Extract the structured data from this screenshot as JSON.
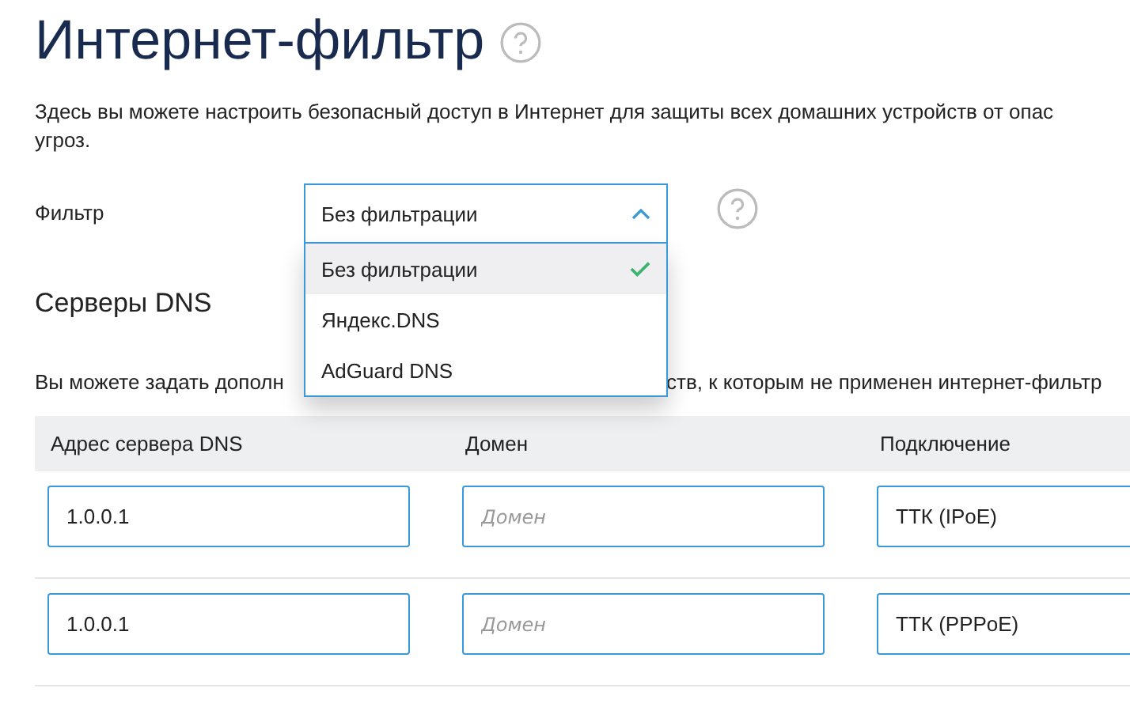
{
  "title": "Интернет-фильтр",
  "description": "Здесь вы можете настроить безопасный доступ в Интернет для защиты всех домашних устройств от опас угроз.",
  "filter": {
    "label": "Фильтр",
    "value": "Без фильтрации",
    "expanded": true,
    "options": [
      {
        "label": "Без фильтрации",
        "selected": true
      },
      {
        "label": "Яндекс.DNS",
        "selected": false
      },
      {
        "label": "AdGuard DNS",
        "selected": false
      }
    ]
  },
  "dns": {
    "heading": "Серверы DNS",
    "text_before": "Вы можете задать дополн",
    "text_after": "ств, к которым не применен интернет-фильтр",
    "table": {
      "columns": [
        "Адрес сервера DNS",
        "Домен",
        "Подключение"
      ],
      "rows": [
        {
          "address": "1.0.0.1",
          "domain_placeholder": "Домен",
          "connection": "ТТК (IPoE)"
        },
        {
          "address": "1.0.0.1",
          "domain_placeholder": "Домен",
          "connection": "ТТК (PPPoE)"
        }
      ]
    }
  }
}
